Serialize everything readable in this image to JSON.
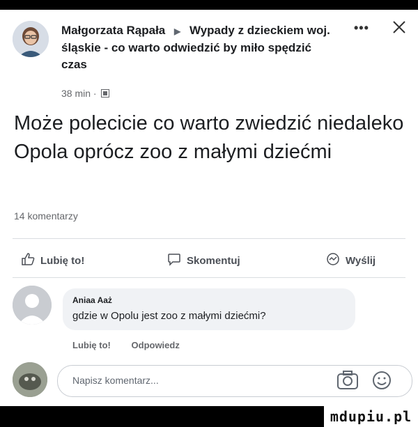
{
  "post": {
    "author": "Małgorzata Rąpała",
    "group": "Wypady z dzieckiem woj. śląskie - co warto odwiedzić by miło spędzić czas",
    "time": "38 min ·",
    "text": "Może polecicie co warto zwiedzić niedaleko Opola oprócz zoo z małymi dziećmi",
    "comments_count": "14 komentarzy"
  },
  "actions": {
    "like": "Lubię to!",
    "comment": "Skomentuj",
    "share": "Wyślij"
  },
  "comment": {
    "author": "Aniaa Aaż",
    "text": "gdzie w Opolu jest zoo z małymi dziećmi?",
    "like": "Lubię to!",
    "reply": "Odpowiedz"
  },
  "composer": {
    "placeholder": "Napisz komentarz..."
  },
  "watermark": "mdupiu.pl",
  "icons": [
    "more-icon",
    "close-icon",
    "globe-icon",
    "like-icon",
    "comment-icon",
    "share-icon",
    "camera-icon",
    "smile-icon"
  ],
  "colors": {
    "text": "#1c1e21",
    "muted": "#65676b",
    "bubble": "#f0f2f5"
  }
}
